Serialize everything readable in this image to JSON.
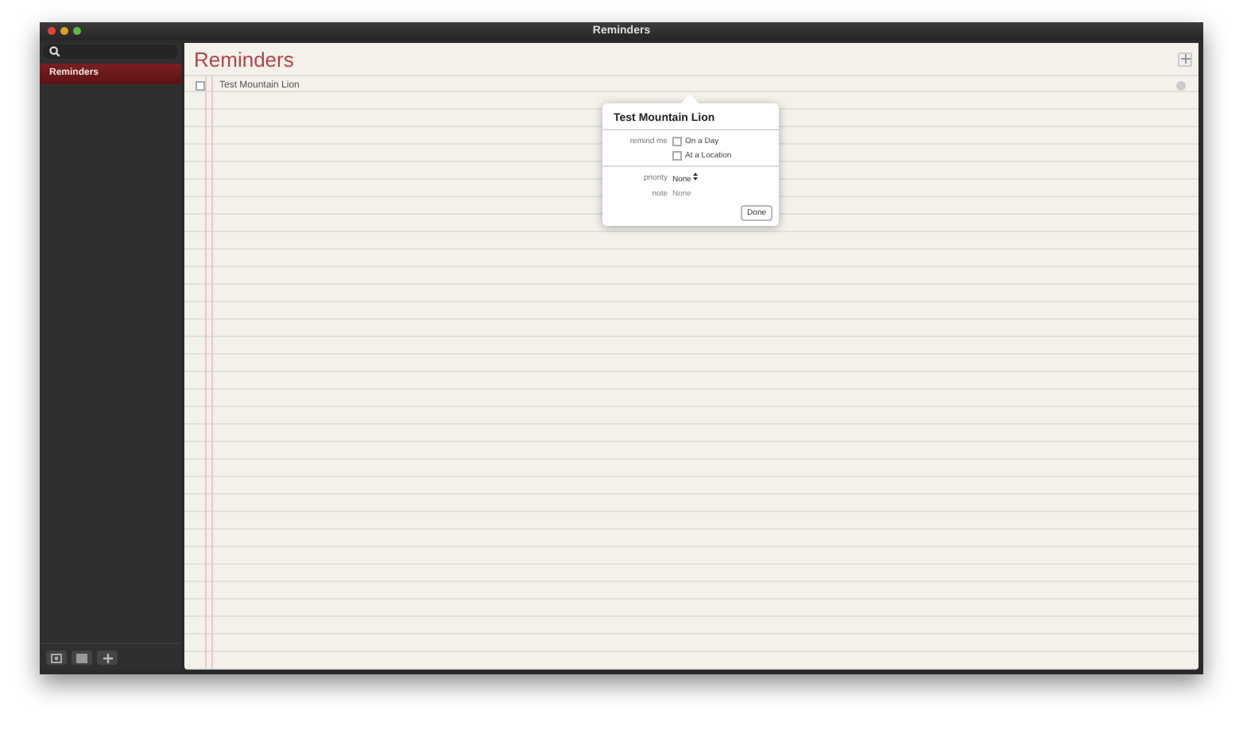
{
  "window": {
    "title": "Reminders"
  },
  "sidebar": {
    "lists": [
      {
        "label": "Reminders",
        "selected": true
      }
    ]
  },
  "main": {
    "title": "Reminders",
    "reminders": [
      {
        "title": "Test Mountain Lion",
        "checked": false
      }
    ]
  },
  "popover": {
    "title": "Test Mountain Lion",
    "remind_label": "remind me",
    "remind_options": [
      {
        "label": "On a Day",
        "checked": false
      },
      {
        "label": "At a Location",
        "checked": false
      }
    ],
    "priority_label": "priority",
    "priority_value": "None",
    "note_label": "note",
    "note_value": "None",
    "done": "Done"
  }
}
